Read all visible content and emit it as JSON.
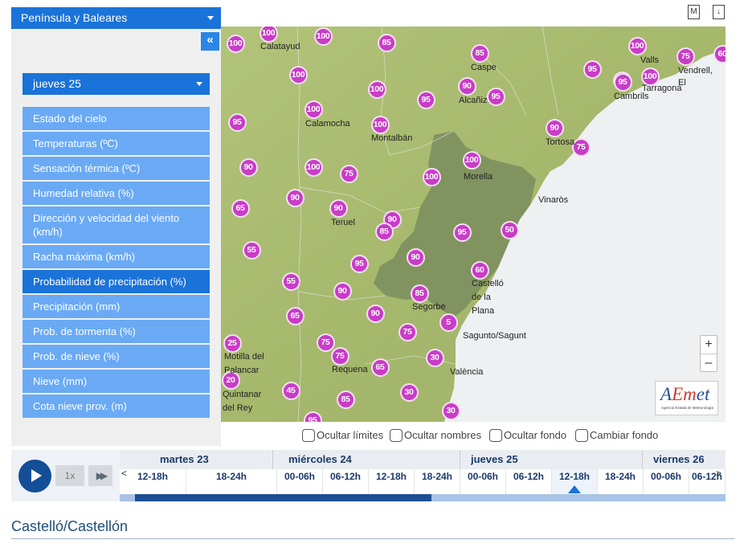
{
  "region_select": {
    "value": "Península y Baleares"
  },
  "collapse_label": "«",
  "day_select": {
    "value": "jueves 25"
  },
  "menu": [
    {
      "label": "Estado del cielo",
      "active": false
    },
    {
      "label": "Temperaturas (ºC)",
      "active": false
    },
    {
      "label": "Sensación térmica (ºC)",
      "active": false
    },
    {
      "label": "Humedad relativa (%)",
      "active": false
    },
    {
      "label": "Dirección y velocidad del viento (km/h)",
      "active": false
    },
    {
      "label": "Racha máxima (km/h)",
      "active": false
    },
    {
      "label": "Probabilidad de precipitación (%)",
      "active": true
    },
    {
      "label": "Precipitación (mm)",
      "active": false
    },
    {
      "label": "Prob. de tormenta (%)",
      "active": false
    },
    {
      "label": "Prob. de nieve (%)",
      "active": false
    },
    {
      "label": "Nieve (mm)",
      "active": false
    },
    {
      "label": "Cota nieve prov. (m)",
      "active": false
    }
  ],
  "top_icons": {
    "m_label": "M",
    "download_label": "↓"
  },
  "map": {
    "markers": [
      "100",
      "100",
      "100",
      "85",
      "85",
      "100",
      "95",
      "75",
      "60",
      "100",
      "90",
      "100",
      "95",
      "95",
      "100",
      "100",
      "95",
      "100",
      "100",
      "95",
      "90",
      "90",
      "100",
      "75",
      "100",
      "100",
      "75",
      "90",
      "90",
      "65",
      "90",
      "95",
      "85",
      "50",
      "55",
      "90",
      "95",
      "55",
      "60",
      "90",
      "85",
      "65",
      "90",
      "5",
      "75",
      "25",
      "75",
      "30",
      "75",
      "65",
      "20",
      "45",
      "30",
      "85",
      "30",
      "95"
    ],
    "towns": [
      "Calatayud",
      "Caspe",
      "Valls",
      "Vendrell,",
      "El",
      "Tarragona",
      "Cambrils",
      "Alcañiz",
      "Calamocha",
      "Montalbán",
      "Tortosa",
      "Morella",
      "Vinaròs",
      "Teruel",
      "Castelló",
      "de la",
      "Plana",
      "Segorbe",
      "Sagunto/Sagunt",
      "Motilla del",
      "Palancar",
      "Requena",
      "València",
      "Quintanar",
      "del Rey"
    ],
    "zoom_in": "+",
    "zoom_out": "–",
    "logo": {
      "a": "A",
      "em": "Em",
      "et": "et",
      "sub": "Agencia Estatal de Meteorología"
    }
  },
  "options": [
    "Ocultar límites",
    "Ocultar nombres",
    "Ocultar fondo",
    "Cambiar fondo"
  ],
  "timeline": {
    "speed": "1x",
    "fast_forward": "▶▶",
    "prev_arrow": "<",
    "next_arrow": ">",
    "days": [
      "martes 23",
      "miércoles 24",
      "jueves 25",
      "viernes 26"
    ],
    "slots": [
      "12-18h",
      "18-24h",
      "00-06h",
      "06-12h",
      "12-18h",
      "18-24h",
      "00-06h",
      "06-12h",
      "12-18h",
      "18-24h",
      "00-06h",
      "06-12h"
    ],
    "active_slot": "12-18h (jueves 25)",
    "progress": 0.49
  },
  "location_title": "Castelló/Castellón"
}
